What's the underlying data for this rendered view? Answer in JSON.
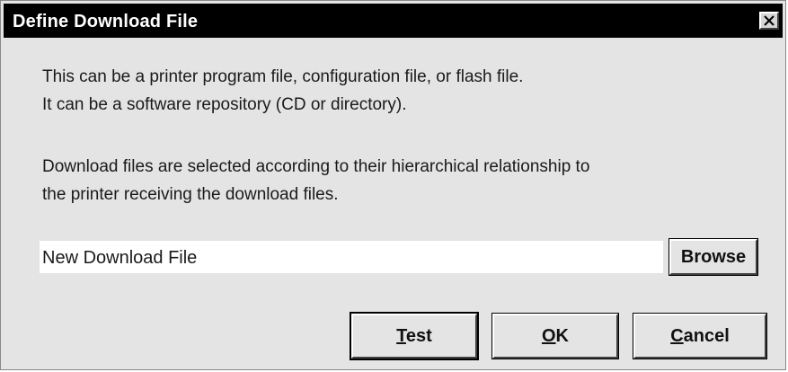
{
  "window": {
    "title": "Define Download File",
    "close_icon": "close-icon"
  },
  "description": {
    "line1": "This can be a printer program file, configuration file, or flash file.",
    "line2": "It can be a software repository (CD or directory).",
    "line3": "Download files are selected according to their hierarchical relationship to",
    "line4": "the printer receiving the download files."
  },
  "file_input": {
    "value": "New Download File"
  },
  "buttons": {
    "browse": "Browse",
    "test": {
      "mnemonic": "T",
      "rest": "est"
    },
    "ok": {
      "mnemonic": "O",
      "rest": "K"
    },
    "cancel": {
      "mnemonic": "C",
      "rest": "ancel"
    }
  },
  "colors": {
    "title_bar": "#000000",
    "dialog_background": "#e4e4e4",
    "input_background": "#ffffff"
  }
}
